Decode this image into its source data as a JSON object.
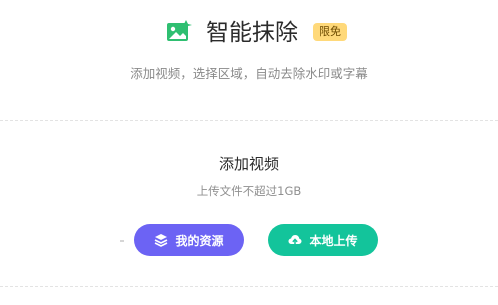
{
  "header": {
    "title": "智能抹除",
    "badge": "限免",
    "subtitle": "添加视频，选择区域，自动去除水印或字幕"
  },
  "upload": {
    "title": "添加视频",
    "hint": "上传文件不超过1GB",
    "buttons": [
      {
        "label": "我的资源",
        "icon": "layers-icon",
        "color": "#6c63f4"
      },
      {
        "label": "本地上传",
        "icon": "cloud-upload-icon",
        "color": "#13c49b"
      }
    ]
  },
  "colors": {
    "app_icon": "#2fbf71",
    "badge_bg": "#ffd97a"
  }
}
